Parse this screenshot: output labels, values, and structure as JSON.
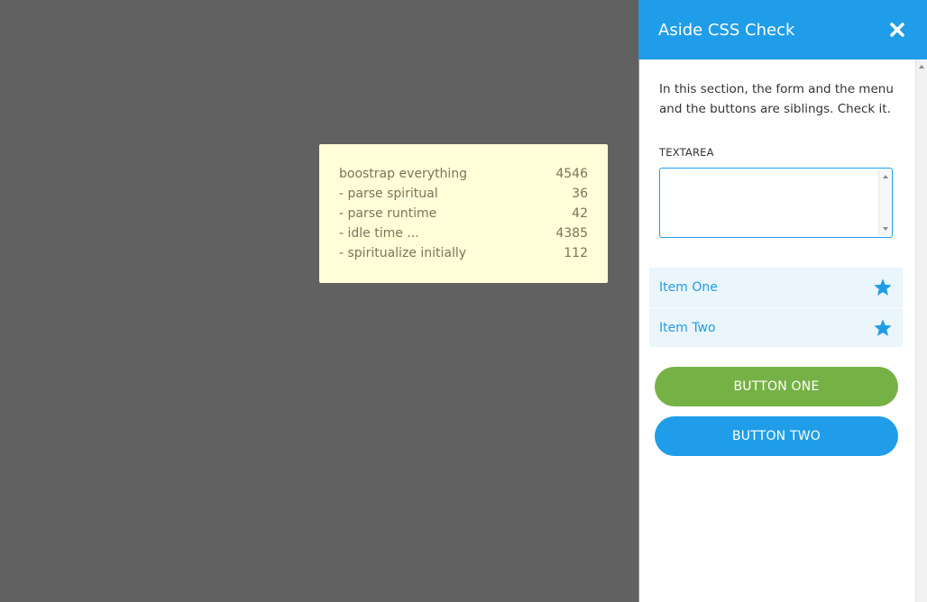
{
  "stats": {
    "rows": [
      {
        "label": "boostrap everything",
        "value": "4546"
      },
      {
        "label": "- parse spiritual",
        "value": "36"
      },
      {
        "label": "- parse runtime",
        "value": "42"
      },
      {
        "label": "- idle time ...",
        "value": "4385"
      },
      {
        "label": "- spiritualize initially",
        "value": "112"
      }
    ]
  },
  "aside": {
    "title": "Aside CSS Check",
    "close_icon": "close-icon",
    "intro": "In this section, the form and the menu and the buttons are siblings. Check it.",
    "textarea": {
      "label": "TEXTAREA",
      "value": ""
    },
    "menu": {
      "items": [
        {
          "label": "Item One",
          "icon": "star-icon"
        },
        {
          "label": "Item Two",
          "icon": "star-icon"
        }
      ]
    },
    "buttons": {
      "one": "BUTTON ONE",
      "two": "BUTTON TWO"
    }
  },
  "colors": {
    "backdrop": "#616161",
    "tooltip_bg": "#ffffd8",
    "accent_blue": "#1f9de8",
    "accent_green": "#76b146",
    "menu_bg": "#eaf5fc"
  }
}
